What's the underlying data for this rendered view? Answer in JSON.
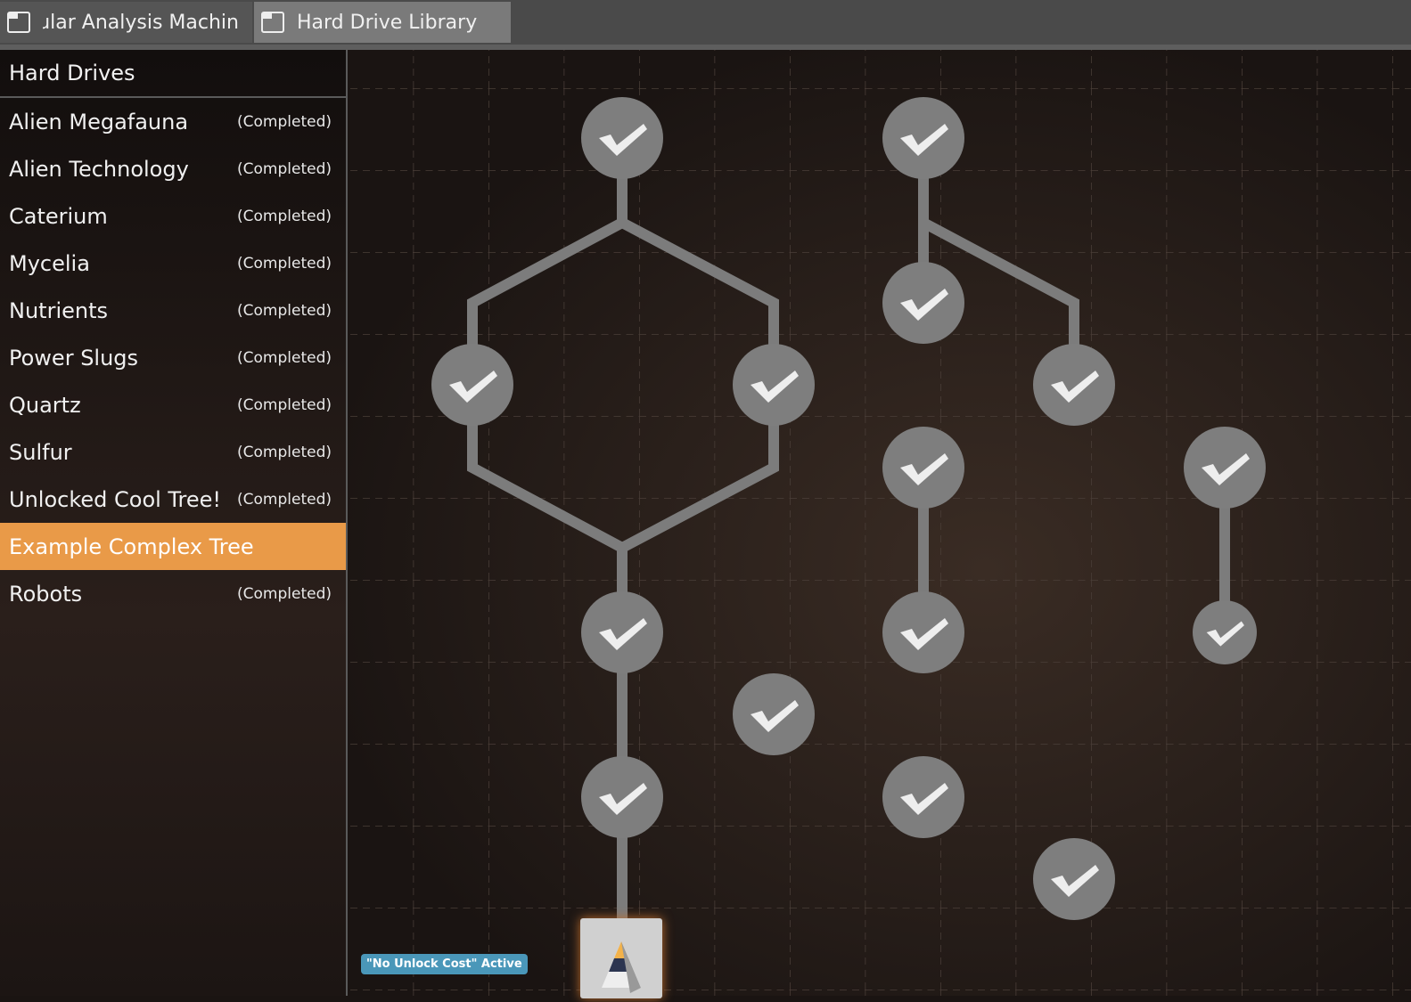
{
  "tabs": [
    {
      "label": "Molecular Analysis Machine",
      "visible": "ular Analysis Machin",
      "icon": "window-icon"
    },
    {
      "label": "Hard Drive Library",
      "icon": "window-icon",
      "active": true
    }
  ],
  "sidebar": {
    "header": "Hard Drives",
    "items": [
      {
        "label": "Alien Megafauna",
        "status": "(Completed)"
      },
      {
        "label": "Alien Technology",
        "status": "(Completed)"
      },
      {
        "label": "Caterium",
        "status": "(Completed)"
      },
      {
        "label": "Mycelia",
        "status": "(Completed)"
      },
      {
        "label": "Nutrients",
        "status": "(Completed)"
      },
      {
        "label": "Power Slugs",
        "status": "(Completed)"
      },
      {
        "label": "Quartz",
        "status": "(Completed)"
      },
      {
        "label": "Sulfur",
        "status": "(Completed)"
      },
      {
        "label": "Unlocked Cool Tree!",
        "status": "(Completed)"
      },
      {
        "label": "Example Complex Tree",
        "status": "",
        "selected": true
      },
      {
        "label": "Robots",
        "status": "(Completed)"
      }
    ]
  },
  "tree": {
    "badge": "\"No Unlock Cost\" Active",
    "node_state": "completed",
    "node_icon": "checkmark-icon",
    "accent": "#e99a48",
    "badge_color": "#4a97b9"
  }
}
